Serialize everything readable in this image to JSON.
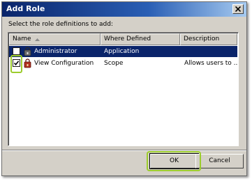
{
  "window": {
    "title": "Add Role",
    "close_icon": "close-icon"
  },
  "instruction": "Select the role definitions to add:",
  "table": {
    "columns": [
      "Name",
      "Where Defined",
      "Description"
    ],
    "sorted_column": "Name",
    "rows": [
      {
        "name": "Administrator",
        "where_defined": "Application",
        "description": "",
        "checked": false,
        "selected": true,
        "icon": "role-icon"
      },
      {
        "name": "View Configuration",
        "where_defined": "Scope",
        "description": "Allows users to ...",
        "checked": true,
        "selected": false,
        "icon": "role-icon"
      }
    ]
  },
  "buttons": {
    "ok": "OK",
    "cancel": "Cancel"
  },
  "colors": {
    "titlebar": "#0a246a",
    "selection": "#0a246a",
    "highlight": "#9ccc2c",
    "dialog_bg": "#d4d0c8"
  }
}
